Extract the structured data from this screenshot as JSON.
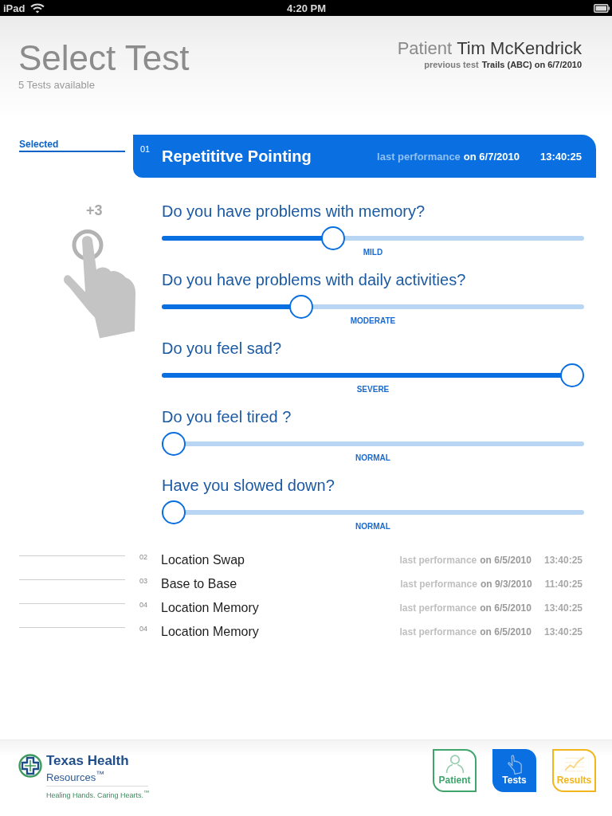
{
  "status_bar": {
    "device": "iPad",
    "time": "4:20 PM"
  },
  "header": {
    "title": "Select Test",
    "subtitle": "5 Tests available",
    "patient_label": "Patient",
    "patient_name": "Tim McKendrick",
    "previous_label": "previous test",
    "previous_value": "Trails (ABC) on 6/7/2010"
  },
  "selected_label": "Selected",
  "tests": [
    {
      "number": "01",
      "name": "Repetititve Pointing",
      "performance_label": "last performance",
      "performance_date": "on 6/7/2010",
      "time": "13:40:25",
      "selected": true
    },
    {
      "number": "02",
      "name": "Location Swap",
      "performance_label": "last performance",
      "performance_date": "on 6/5/2010",
      "time": "13:40:25",
      "selected": false
    },
    {
      "number": "03",
      "name": "Base to Base",
      "performance_label": "last performance",
      "performance_date": "on 9/3/2010",
      "time": "11:40:25",
      "selected": false
    },
    {
      "number": "04",
      "name": "Location Memory",
      "performance_label": "last performance",
      "performance_date": "on 6/5/2010",
      "time": "13:40:25",
      "selected": false
    },
    {
      "number": "04",
      "name": "Location Memory",
      "performance_label": "last performance",
      "performance_date": "on 6/5/2010",
      "time": "13:40:25",
      "selected": false
    }
  ],
  "questionnaire": {
    "hint": "+3",
    "questions": [
      {
        "text": "Do you have problems with memory?",
        "level": 0.4,
        "reading": "MILD"
      },
      {
        "text": "Do you have problems with daily activities?",
        "level": 0.32,
        "reading": "MODERATE"
      },
      {
        "text": "Do you feel sad?",
        "level": 1,
        "reading": "SEVERE"
      },
      {
        "text": "Do you feel tired ?",
        "level": 0,
        "reading": "NORMAL"
      },
      {
        "text": "Have you slowed down?",
        "level": 0,
        "reading": "NORMAL"
      }
    ]
  },
  "footer": {
    "logo": {
      "name": "Texas Health",
      "subname": "Resources$^{™}$",
      "tagline": "Healing Hands. Caring Hearts.$^{™}$"
    },
    "tabs": [
      {
        "label": "Patient",
        "kind": "patient",
        "selected": false,
        "color": "#3fa56c"
      },
      {
        "label": "Tests",
        "kind": "tests",
        "selected": true,
        "color": "#0a6fe0"
      },
      {
        "label": "Results",
        "kind": "results",
        "selected": false,
        "color": "#f2b51c"
      }
    ]
  }
}
